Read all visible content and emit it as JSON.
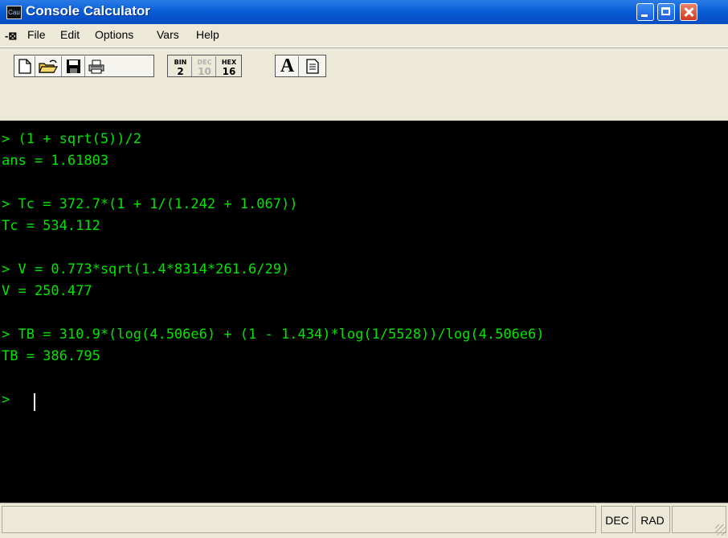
{
  "window": {
    "title": "Console Calculator",
    "app_icon_text": "Cau",
    "controls": [
      "minimize",
      "maximize",
      "close"
    ]
  },
  "menubar": {
    "items": [
      "File",
      "Edit",
      "Options",
      "Vars",
      "Help"
    ]
  },
  "toolbar": {
    "file_buttons": [
      "new-file-icon",
      "open-folder-icon",
      "save-disk-icon",
      "print-icon"
    ],
    "base_buttons": [
      {
        "label": "BIN",
        "digit": "2",
        "enabled": true
      },
      {
        "label": "DEC",
        "digit": "10",
        "enabled": false
      },
      {
        "label": "HEX",
        "digit": "16",
        "enabled": true
      }
    ],
    "font_button": "A",
    "extra_button": "list-doc-icon"
  },
  "console": {
    "lines": [
      "> (1 + sqrt(5))/2",
      "ans = 1.61803",
      "",
      "> Tc = 372.7*(1 + 1/(1.242 + 1.067))",
      "Tc = 534.112",
      "",
      "> V = 0.773*sqrt(1.4*8314*261.6/29)",
      "V = 250.477",
      "",
      "> TB = 310.9*(log(4.506e6) + (1 - 1.434)*log(1/5528))/log(4.506e6)",
      "TB = 386.795",
      "",
      ">"
    ],
    "text_color": "#00e500",
    "background": "#000000"
  },
  "statusbar": {
    "main_text": "",
    "mode": "DEC",
    "angle": "RAD"
  }
}
